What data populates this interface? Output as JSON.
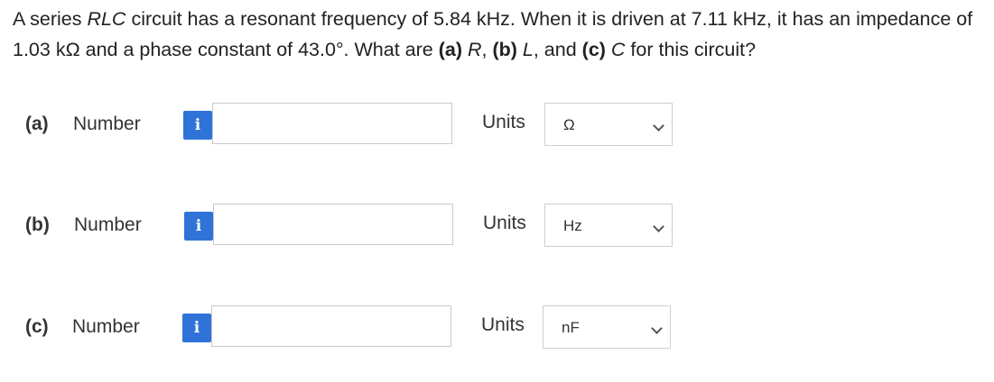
{
  "question": {
    "t1": "A series ",
    "t2": "RLC",
    "t3": " circuit has a resonant frequency of 5.84 kHz. When it is driven at 7.11 kHz, it has an impedance of 1.03 kΩ and a phase constant of 43.0°. What are ",
    "t4": "(a)",
    "t5": " ",
    "t6": "R",
    "t7": ", ",
    "t8": "(b)",
    "t9": " ",
    "t10": "L",
    "t11": ", and ",
    "t12": "(c)",
    "t13": " ",
    "t14": "C",
    "t15": " for this circuit?"
  },
  "parts": [
    {
      "label": "(a)",
      "number_label": "Number",
      "info_icon": "i",
      "value": "",
      "units_label": "Units",
      "unit": "Ω"
    },
    {
      "label": "(b)",
      "number_label": "Number",
      "info_icon": "i",
      "value": "",
      "units_label": "Units",
      "unit": "Hz"
    },
    {
      "label": "(c)",
      "number_label": "Number",
      "info_icon": "i",
      "value": "",
      "units_label": "Units",
      "unit": "nF"
    }
  ],
  "colors": {
    "info_button": "#2f73d9",
    "border": "#c9c9c9"
  },
  "icons": {
    "info": "info-icon",
    "dropdown": "chevron-down-icon"
  }
}
